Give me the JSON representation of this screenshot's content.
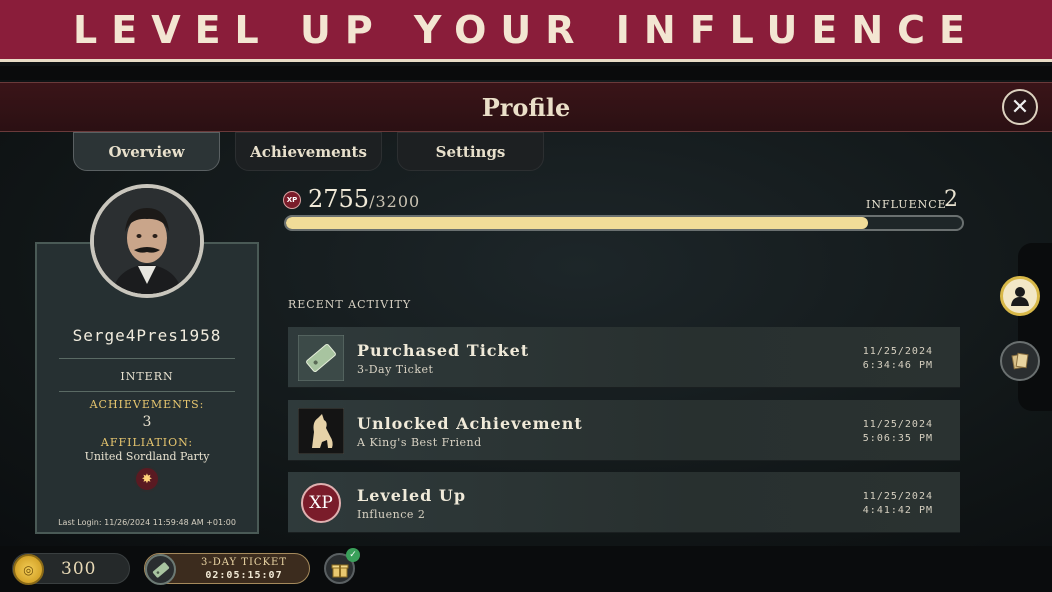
{
  "banner": {
    "text": "LEVEL UP YOUR INFLUENCE"
  },
  "header": {
    "title": "Profile",
    "close_icon": "close-icon"
  },
  "tabs": [
    {
      "label": "Overview",
      "active": true
    },
    {
      "label": "Achievements",
      "active": false
    },
    {
      "label": "Settings",
      "active": false
    }
  ],
  "profile": {
    "username": "Serge4Pres1958",
    "rank": "INTERN",
    "achievements_label": "ACHIEVEMENTS:",
    "achievements_count": "3",
    "affiliation_label": "AFFILIATION:",
    "affiliation": "United Sordland Party",
    "last_login": "Last Login: 11/26/2024 11:59:48 AM +01:00"
  },
  "xp": {
    "badge": "XP",
    "current": "2755",
    "max": "/3200",
    "progress_fraction": 0.861
  },
  "influence": {
    "label": "INFLUENCE",
    "value": "2"
  },
  "recent": {
    "title": "RECENT ACTIVITY",
    "items": [
      {
        "title": "Purchased Ticket",
        "subtitle": "3-Day Ticket",
        "date": "11/25/2024",
        "time": "6:34:46 PM",
        "icon": "ticket-icon"
      },
      {
        "title": "Unlocked Achievement",
        "subtitle": "A King's Best Friend",
        "date": "11/25/2024",
        "time": "5:06:35 PM",
        "icon": "dog-icon"
      },
      {
        "title": "Leveled Up",
        "subtitle": "Influence 2",
        "date": "11/25/2024",
        "time": "4:41:42 PM",
        "icon": "xp-icon",
        "icon_text": "XP"
      }
    ]
  },
  "bottom": {
    "coins": "300",
    "ticket_label": "3-DAY TICKET",
    "ticket_time": "02:05:15:07"
  },
  "colors": {
    "banner": "#8a1d3a",
    "accent_gold": "#f1dc98",
    "xp_red": "#7a1c2a"
  }
}
